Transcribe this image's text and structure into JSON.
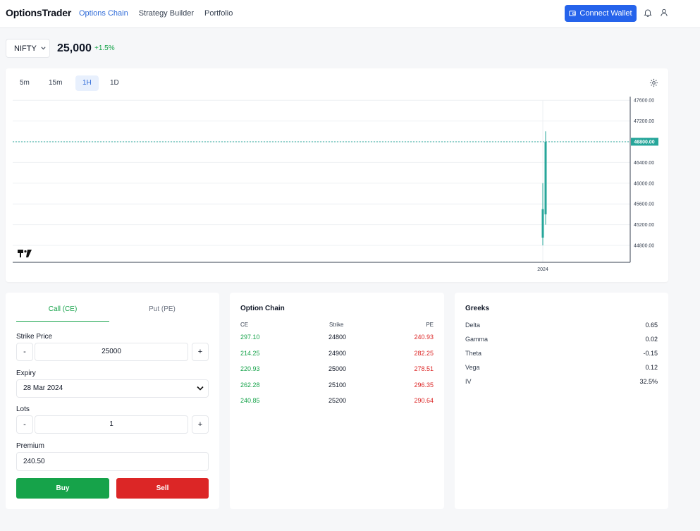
{
  "header": {
    "brand": "OptionsTrader",
    "nav": [
      {
        "label": "Options Chain",
        "active": true
      },
      {
        "label": "Strategy Builder",
        "active": false
      },
      {
        "label": "Portfolio",
        "active": false
      }
    ],
    "connect_label": "Connect Wallet",
    "icons": [
      "wallet-icon",
      "bell-icon",
      "user-icon"
    ]
  },
  "ticker": {
    "symbol": "NIFTY",
    "price": "25,000",
    "change": "+1.5%"
  },
  "chart": {
    "timeframes": [
      "5m",
      "15m",
      "1H",
      "1D"
    ],
    "active_timeframe": "1H",
    "y_ticks": [
      "47600.00",
      "47200.00",
      "46400.00",
      "46000.00",
      "45600.00",
      "45200.00",
      "44800.00"
    ],
    "current_price_label": "46800.00",
    "x_label": "2024",
    "colors": {
      "up": "#26a69a",
      "price_line": "#26a69a",
      "grid": "#eef0f3"
    }
  },
  "chart_data": {
    "type": "candlestick",
    "y_ticks": [
      44800,
      45200,
      45600,
      46000,
      46400,
      46800,
      47200,
      47600
    ],
    "current_price": 46800,
    "x_ticks": [
      "2024"
    ],
    "candles": [
      {
        "open": 44950,
        "close": 45500,
        "high": 46000,
        "low": 44800
      },
      {
        "open": 45400,
        "close": 46800,
        "high": 47000,
        "low": 45200
      }
    ]
  },
  "order": {
    "tabs": [
      "Call (CE)",
      "Put (PE)"
    ],
    "active_tab": "Call (CE)",
    "strike_label": "Strike Price",
    "strike_value": "25000",
    "expiry_label": "Expiry",
    "expiry_value": "28 Mar 2024",
    "lots_label": "Lots",
    "lots_value": "1",
    "premium_label": "Premium",
    "premium_value": "240.50",
    "minus": "-",
    "plus": "+",
    "buy_label": "Buy",
    "sell_label": "Sell"
  },
  "option_chain": {
    "title": "Option Chain",
    "headers": [
      "CE",
      "Strike",
      "PE"
    ],
    "rows": [
      {
        "ce": "297.10",
        "strike": "24800",
        "pe": "240.93"
      },
      {
        "ce": "214.25",
        "strike": "24900",
        "pe": "282.25"
      },
      {
        "ce": "220.93",
        "strike": "25000",
        "pe": "278.51"
      },
      {
        "ce": "262.28",
        "strike": "25100",
        "pe": "296.35"
      },
      {
        "ce": "240.85",
        "strike": "25200",
        "pe": "290.64"
      }
    ]
  },
  "greeks": {
    "title": "Greeks",
    "items": [
      {
        "name": "Delta",
        "value": "0.65"
      },
      {
        "name": "Gamma",
        "value": "0.02"
      },
      {
        "name": "Theta",
        "value": "-0.15"
      },
      {
        "name": "Vega",
        "value": "0.12"
      },
      {
        "name": "IV",
        "value": "32.5%"
      }
    ]
  }
}
